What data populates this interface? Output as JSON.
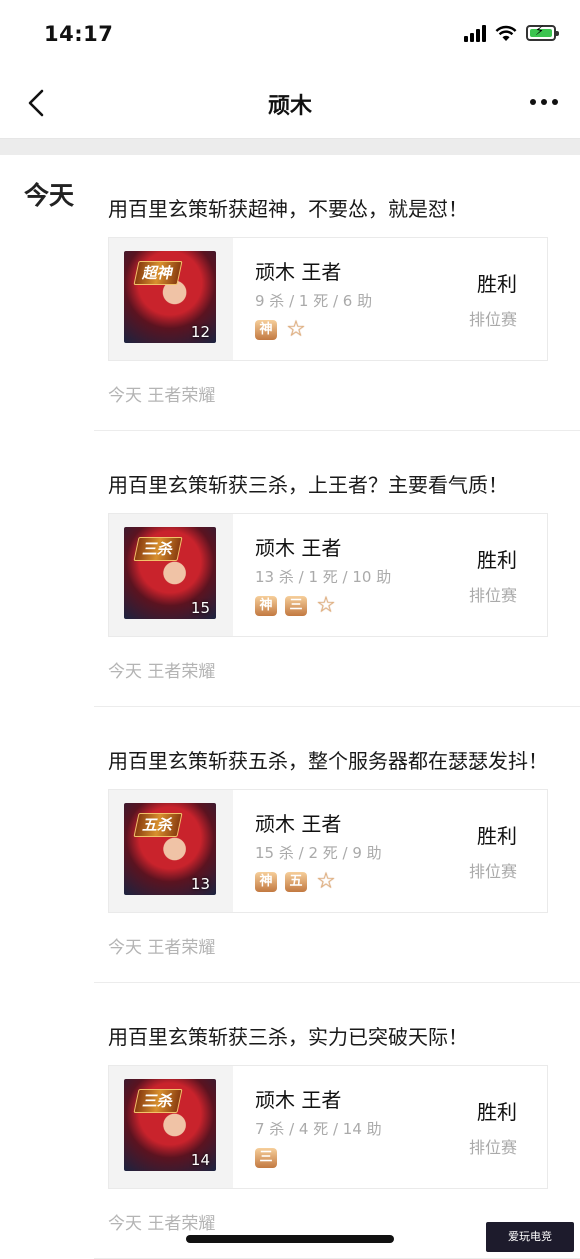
{
  "status_bar": {
    "time": "14:17"
  },
  "nav": {
    "title": "顽木"
  },
  "day_label": "今天",
  "posts": [
    {
      "text": "用百里玄策斩获超神，不要怂，就是怼！",
      "badge": "超神",
      "level": "12",
      "player": "顽木 王者",
      "kda": "9 杀 / 1 死 / 6 助",
      "medals": [
        "神",
        "☆"
      ],
      "result": "胜利",
      "mode": "排位赛",
      "meta": "今天  王者荣耀"
    },
    {
      "text": "用百里玄策斩获三杀，上王者？主要看气质！",
      "badge": "三杀",
      "level": "15",
      "player": "顽木 王者",
      "kda": "13 杀 / 1 死 / 10 助",
      "medals": [
        "神",
        "三",
        "☆"
      ],
      "result": "胜利",
      "mode": "排位赛",
      "meta": "今天  王者荣耀"
    },
    {
      "text": "用百里玄策斩获五杀，整个服务器都在瑟瑟发抖！",
      "badge": "五杀",
      "level": "13",
      "player": "顽木 王者",
      "kda": "15 杀 / 2 死 / 9 助",
      "medals": [
        "神",
        "五",
        "☆"
      ],
      "result": "胜利",
      "mode": "排位赛",
      "meta": "今天  王者荣耀"
    },
    {
      "text": "用百里玄策斩获三杀，实力已突破天际！",
      "badge": "三杀",
      "level": "14",
      "player": "顽木 王者",
      "kda": "7 杀 / 4 死 / 14 助",
      "medals": [
        "三"
      ],
      "result": "胜利",
      "mode": "排位赛",
      "meta": "今天  王者荣耀"
    }
  ],
  "watermark": "爱玩电竞"
}
